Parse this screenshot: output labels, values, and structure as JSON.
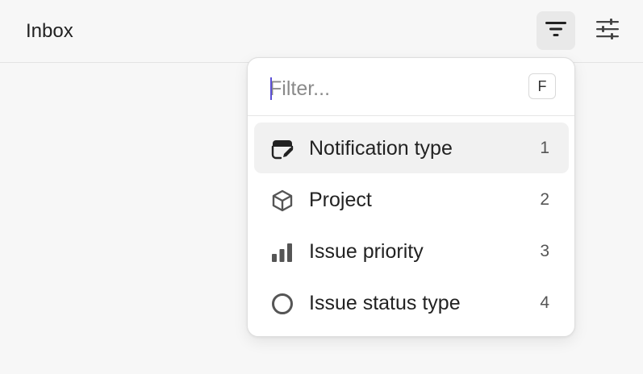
{
  "header": {
    "title": "Inbox"
  },
  "dropdown": {
    "search": {
      "placeholder": "Filter...",
      "value": "",
      "shortcut": "F"
    },
    "items": [
      {
        "label": "Notification type",
        "shortcut": "1",
        "icon": "notification-type-icon",
        "active": true
      },
      {
        "label": "Project",
        "shortcut": "2",
        "icon": "cube-icon",
        "active": false
      },
      {
        "label": "Issue priority",
        "shortcut": "3",
        "icon": "priority-bars-icon",
        "active": false
      },
      {
        "label": "Issue status type",
        "shortcut": "4",
        "icon": "circle-status-icon",
        "active": false
      }
    ]
  },
  "colors": {
    "background": "#f7f7f7",
    "menu_bg": "#ffffff",
    "active_item": "#f1f1f1",
    "caret": "#5b4fd6"
  }
}
